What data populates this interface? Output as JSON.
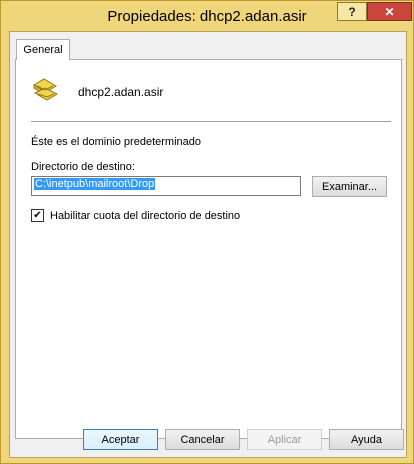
{
  "window": {
    "title": "Propiedades: dhcp2.adan.asir",
    "help_button": "?",
    "close_button": "✕"
  },
  "tabs": [
    {
      "label": "General",
      "active": true
    }
  ],
  "general": {
    "site_name": "dhcp2.adan.asir",
    "default_domain_text": "Éste es el dominio predeterminado",
    "directory_label": "Directorio de destino:",
    "directory_value": "C:\\inetpub\\mailroot\\Drop",
    "browse_button": "Examinar...",
    "quota_checkbox_label": "Habilitar cuota del directorio de destino",
    "quota_checked": true
  },
  "buttons": {
    "ok": "Aceptar",
    "cancel": "Cancelar",
    "apply": "Aplicar",
    "help": "Ayuda"
  },
  "colors": {
    "titlebar": "#f0d67a",
    "close_button": "#c9463d",
    "selection": "#3399ff"
  }
}
